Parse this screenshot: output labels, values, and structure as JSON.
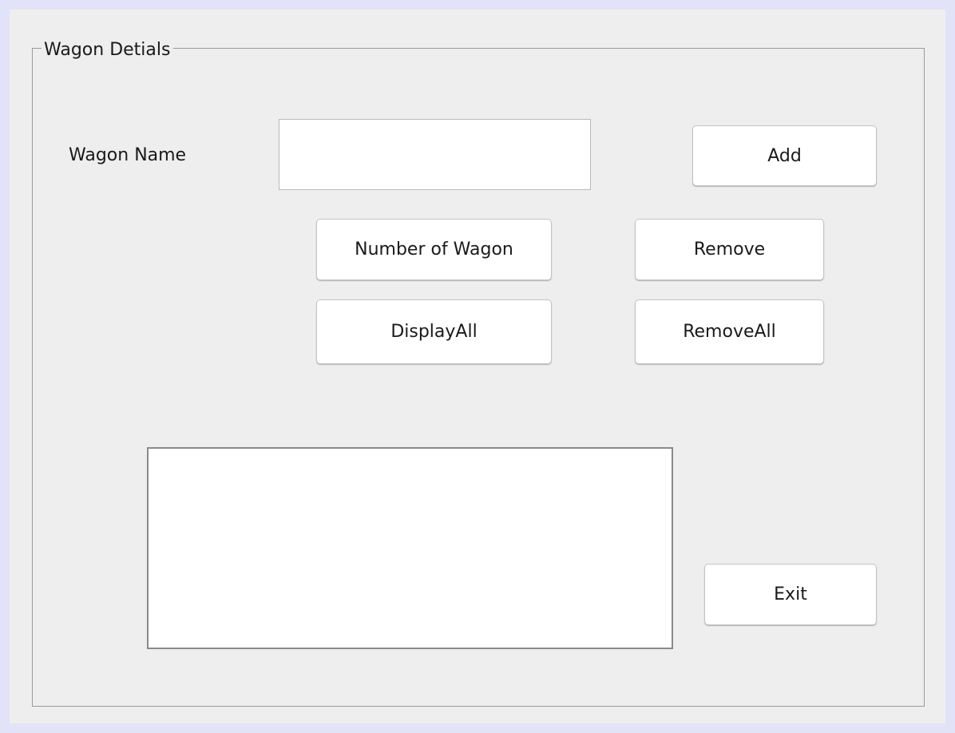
{
  "panel": {
    "title": "Wagon Detials"
  },
  "form": {
    "wagon_name_label": "Wagon Name",
    "wagon_name_value": ""
  },
  "buttons": {
    "add": "Add",
    "number_of_wagon": "Number of Wagon",
    "remove": "Remove",
    "display_all": "DisplayAll",
    "remove_all": "RemoveAll",
    "exit": "Exit"
  },
  "output": {
    "value": ""
  },
  "colors": {
    "outer_border": "#e2e3f9",
    "window_background": "#eeeeee",
    "control_background": "#ffffff"
  }
}
